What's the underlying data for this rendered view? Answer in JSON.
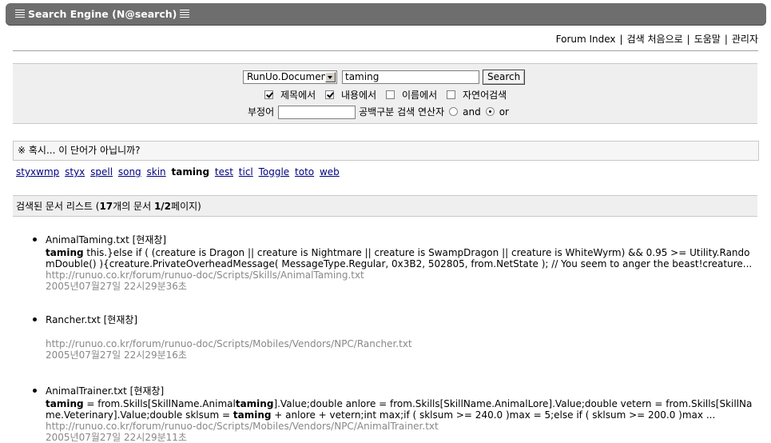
{
  "title": "Search Engine (N@search)",
  "nav": {
    "forum_index": "Forum Index",
    "search_home": "검색 처음으로",
    "help": "도움말",
    "admin": "관리자",
    "sep": "|"
  },
  "search": {
    "scope_selected": "RunUo.Document",
    "query": "taming",
    "button": "Search",
    "opt_title": "제목에서",
    "opt_title_checked": true,
    "opt_content": "내용에서",
    "opt_content_checked": true,
    "opt_name": "이름에서",
    "opt_name_checked": false,
    "opt_natural": "자연어검색",
    "opt_natural_checked": false,
    "negative_label": "부정어",
    "negative_value": "",
    "operator_label": "공백구분 검색 연산자",
    "op_and": "and",
    "op_or": "or",
    "op_selected": "or"
  },
  "suggestion": {
    "header": "※ 혹시... 이 단어가 아닙니까?",
    "words": [
      "styxwmp",
      "styx",
      "spell",
      "song",
      "skin",
      "taming",
      "test",
      "ticl",
      "Toggle",
      "toto",
      "web"
    ],
    "current": "taming"
  },
  "list": {
    "head_prefix": "검색된 문서 리스트 (",
    "count": "17",
    "head_mid": "개의 문서 ",
    "page": "1/2",
    "head_suffix": "페이지)"
  },
  "results": [
    {
      "title": "AnimalTaming.txt [현재창]",
      "snippet": [
        {
          "b": "taming"
        },
        {
          "t": " this.}else if ( (creature is Dragon || creature is Nightmare || creature is SwampDragon || creature is WhiteWyrm) && 0.95 >= Utility.RandomDouble() ){creature.PrivateOverheadMessage( MessageType.Regular, 0x3B2, 502805, from.NetState ); // You seem to anger the beast!creature..."
        }
      ],
      "url": "http://runuo.co.kr/forum/runuo-doc/Scripts/Skills/AnimalTaming.txt",
      "date": "2005년07월27일 22시29분36초"
    },
    {
      "title": "Rancher.txt [현재창]",
      "snippet": [],
      "url": "http://runuo.co.kr/forum/runuo-doc/Scripts/Mobiles/Vendors/NPC/Rancher.txt",
      "date": "2005년07월27일 22시29분16초"
    },
    {
      "title": "AnimalTrainer.txt [현재창]",
      "snippet": [
        {
          "b": "taming"
        },
        {
          "t": " = from.Skills[SkillName.Animal"
        },
        {
          "b": "taming"
        },
        {
          "t": "].Value;double anlore = from.Skills[SkillName.AnimalLore].Value;double vetern = from.Skills[SkillName.Veterinary].Value;double sklsum = "
        },
        {
          "b": "taming"
        },
        {
          "t": " + anlore + vetern;int max;if ( sklsum >= 240.0 )max = 5;else if ( sklsum >= 200.0 )max ..."
        }
      ],
      "url": "http://runuo.co.kr/forum/runuo-doc/Scripts/Mobiles/Vendors/NPC/AnimalTrainer.txt",
      "date": "2005년07월27일 22시29분11초"
    }
  ]
}
